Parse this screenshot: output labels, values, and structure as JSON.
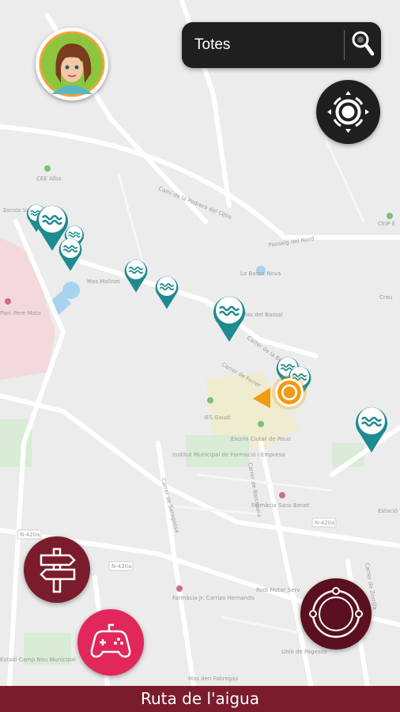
{
  "search": {
    "value": "Totes"
  },
  "footer": {
    "title": "Ruta de l'aigua"
  },
  "colors": {
    "marker_teal": "#1f8a8f",
    "route_button": "#7a1c2c",
    "game_button": "#e2275a",
    "compass_button": "#5a1020",
    "user_location": "#f29a11",
    "footer_bar": "#7a1c2c"
  },
  "icons": {
    "avatar": "user-avatar-icon",
    "search": "magnifier-icon",
    "locate": "gps-target-icon",
    "route": "signpost-icon",
    "game": "gamepad-icon",
    "compass": "compass-ring-icon",
    "marker": "water-wave-icon"
  },
  "map": {
    "streets": [
      "Camí de la Pedrera del Cèlio",
      "Passeig del Nord",
      "Carrer de la Bona de",
      "Carrer de Ferrer",
      "Carrer de Saragossa",
      "Carrer de Barcelona",
      "Carrer de Zorrilla",
      "N-420a"
    ],
    "places": [
      "CEE Alba",
      "Escola Sol",
      "CEIP E",
      "La Bassa Nova",
      "Mas del Bassal",
      "IES Gaudí",
      "Escola Ciutat de Reus",
      "Institut Municipal de Formació i Empresa",
      "Farmàcia Sans Benet",
      "Farmàcia Jr. Carrizo Hernando",
      "Rodi Motor Serv",
      "Uniò de Pagesos",
      "Mas den Fabregas",
      "Estadi Camp Nou Municipal",
      "Parc Pere Mata",
      "Mas Molinet",
      "Estació",
      "Creu"
    ]
  }
}
